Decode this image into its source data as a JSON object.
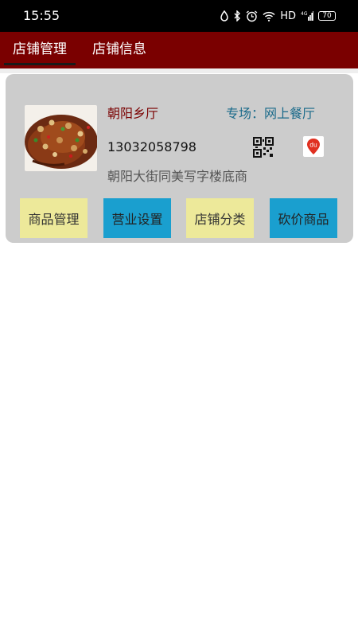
{
  "status_bar": {
    "time": "15:55",
    "network": "HD",
    "signal": "4G",
    "battery": "70"
  },
  "tabs": [
    {
      "label": "店铺管理",
      "active": true
    },
    {
      "label": "店铺信息",
      "active": false
    }
  ],
  "shop": {
    "name": "朝阳乡厅",
    "special": "专场：网上餐厅",
    "phone": "13032058798",
    "address": "朝阳大街同美写字楼底商",
    "map_icon_text": "du"
  },
  "actions": [
    {
      "label": "商品管理",
      "color": "#ede99a"
    },
    {
      "label": "营业设置",
      "color": "#1a9fcf"
    },
    {
      "label": "店铺分类",
      "color": "#ede99a"
    },
    {
      "label": "砍价商品",
      "color": "#1a9fcf"
    }
  ],
  "colors": {
    "tab_bar": "#7a0000",
    "card": "#cccccc",
    "shop_name": "#7a0000",
    "special": "#1a6a8a"
  }
}
